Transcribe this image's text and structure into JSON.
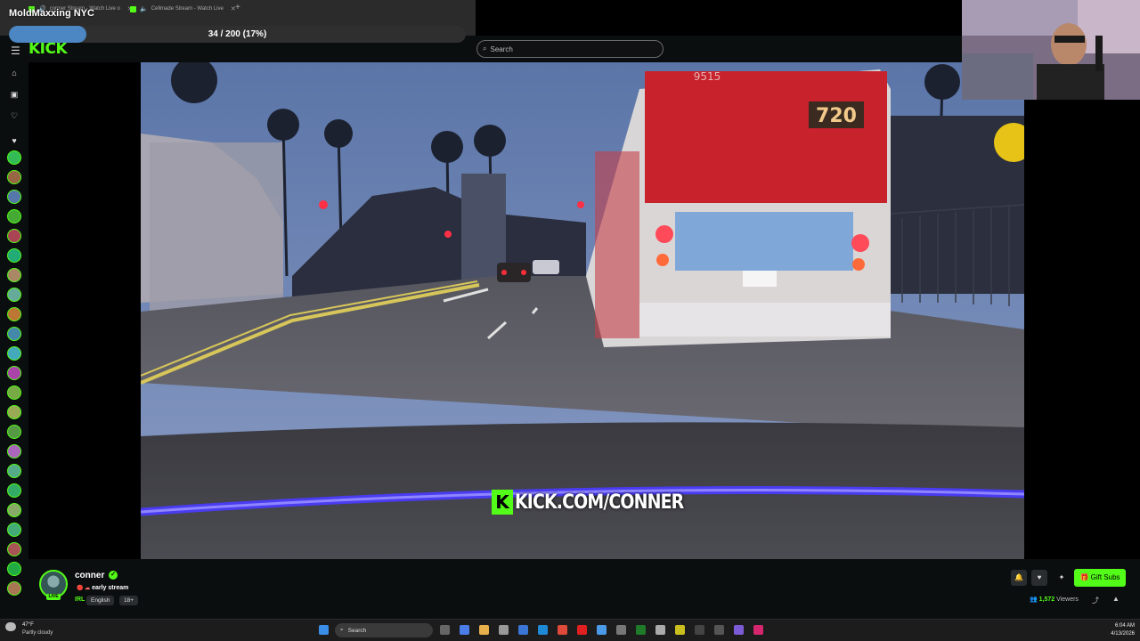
{
  "browser": {
    "tabs": [
      {
        "title": "conner Stream - Watch Live o"
      },
      {
        "title": "Cellmade Stream - Watch Live"
      }
    ],
    "new_tab": "+"
  },
  "overlay": {
    "title": "MoldMaxxing NYC",
    "progress_text": "34 / 200 (17%)",
    "progress_fraction": 0.17
  },
  "header": {
    "logo": "KICK",
    "search_placeholder": "Search"
  },
  "video": {
    "watermark_k": "K",
    "watermark_url": "KICK.COM/CONNER",
    "bus_route": "720",
    "bus_number": "9515"
  },
  "stream": {
    "name": "conner",
    "verified": "✓",
    "live": "LIVE",
    "title": "early stream",
    "title_emoji": "🔴 ☁",
    "category": "IRL",
    "tags": [
      "English",
      "18+"
    ],
    "gift_label": "Gift Subs",
    "viewers_count": "1,572",
    "viewers_label": "Viewers"
  },
  "taskbar": {
    "temp": "47°F",
    "weather": "Partly cloudy",
    "search_label": "Search",
    "time": "6:04 AM",
    "date": "4/13/2026"
  },
  "colors": {
    "accent": "#53fc18",
    "progress": "#4c87c4"
  }
}
